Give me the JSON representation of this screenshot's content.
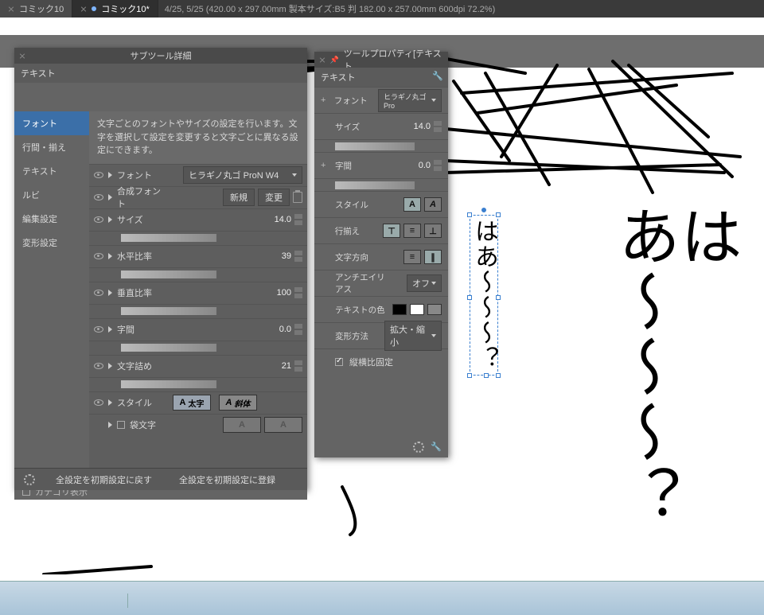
{
  "tabs": {
    "inactive": "コミック10",
    "active": "コミック10*",
    "status": "4/25, 5/25 (420.00 x 297.00mm 製本サイズ:B5 判 182.00 x 257.00mm 600dpi 72.2%)"
  },
  "canvas": {
    "text_big": "はあ〜〜〜？",
    "text_small": "はあ〜〜〜？"
  },
  "subtool": {
    "title": "サブツール詳細",
    "section": "テキスト",
    "sidebar": [
      "フォント",
      "行間・揃え",
      "テキスト",
      "ルビ",
      "編集設定",
      "変形設定"
    ],
    "help": "文字ごとのフォントやサイズの設定を行います。文字を選択して設定を変更すると文字ごとに異なる設定にできます。",
    "rows": {
      "font_label": "フォント",
      "font_value": "ヒラギノ丸ゴ ProN W4",
      "synth_label": "合成フォント",
      "synth_new": "新規",
      "synth_change": "変更",
      "size_label": "サイズ",
      "size_value": "14.0",
      "hratio_label": "水平比率",
      "hratio_value": "39",
      "vratio_label": "垂直比率",
      "vratio_value": "100",
      "spacing_label": "字間",
      "spacing_value": "0.0",
      "kerning_label": "文字詰め",
      "kerning_value": "21",
      "style_label": "スタイル",
      "style_bold": "太字",
      "style_italic": "斜体",
      "outline_label": "袋文字"
    },
    "category_label": "カテゴリ表示",
    "footer_reset": "全設定を初期設定に戻す",
    "footer_save": "全設定を初期設定に登録"
  },
  "toolprop": {
    "title": "ツールプロパティ[テキスト",
    "section": "テキスト",
    "font_label": "フォント",
    "font_value": "ヒラギノ丸ゴ Pro",
    "size_label": "サイズ",
    "size_value": "14.0",
    "spacing_label": "字間",
    "spacing_value": "0.0",
    "style_label": "スタイル",
    "align_label": "行揃え",
    "direction_label": "文字方向",
    "aa_label": "アンチエイリアス",
    "aa_value": "オフ",
    "color_label": "テキストの色",
    "transform_label": "変形方法",
    "transform_value": "拡大・縮小",
    "lock_label": "縦横比固定"
  }
}
